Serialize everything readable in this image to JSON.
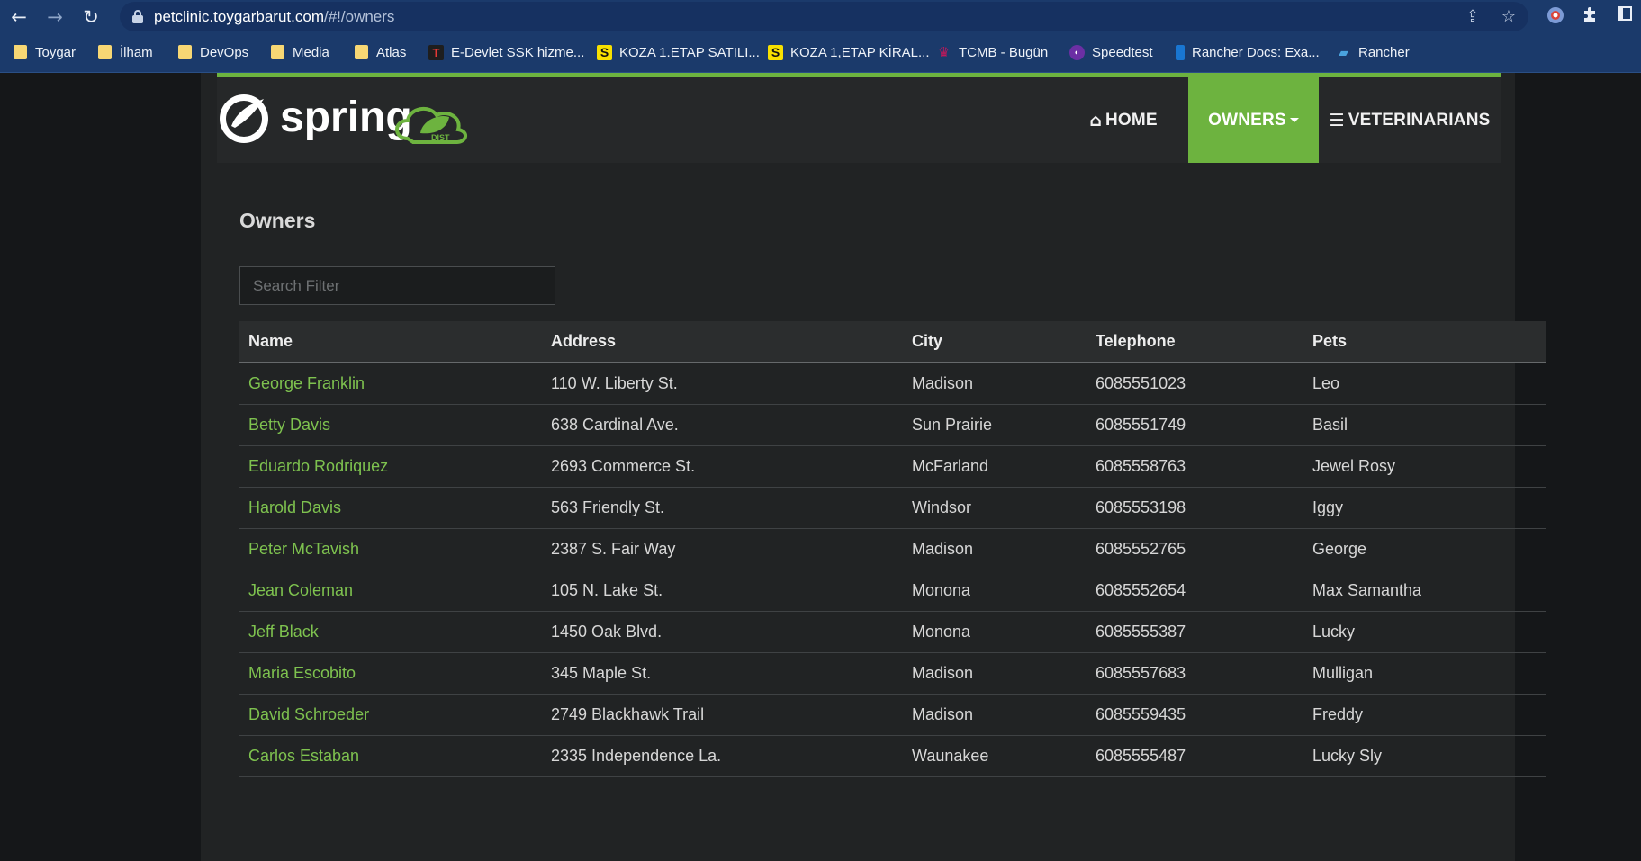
{
  "browser": {
    "url_host": "petclinic.toygarbarut.com",
    "url_path": "/#!/owners",
    "bookmarks": [
      {
        "label": "Toygar",
        "icon": "folder-icon"
      },
      {
        "label": "İlham",
        "icon": "folder-icon"
      },
      {
        "label": "DevOps",
        "icon": "folder-icon"
      },
      {
        "label": "Media",
        "icon": "folder-icon"
      },
      {
        "label": "Atlas",
        "icon": "folder-icon"
      },
      {
        "label": "E-Devlet SSK hizme...",
        "icon": "edevlet-icon"
      },
      {
        "label": "KOZA 1.ETAP SATILI...",
        "icon": "s-badge-icon"
      },
      {
        "label": "KOZA 1,ETAP KİRAL...",
        "icon": "s-badge-icon"
      },
      {
        "label": "TCMB - Bugün",
        "icon": "tcmb-icon"
      },
      {
        "label": "Speedtest",
        "icon": "speedtest-icon"
      },
      {
        "label": "Rancher Docs: Exa...",
        "icon": "rancher-docs-icon"
      },
      {
        "label": "Rancher",
        "icon": "rancher-icon"
      }
    ]
  },
  "navbar": {
    "home_label": "HOME",
    "owners_label": "OWNERS",
    "vets_label": "VETERINARIANS",
    "accent_color": "#6db33f"
  },
  "main": {
    "title": "Owners",
    "search_placeholder": "Search Filter",
    "columns": [
      "Name",
      "Address",
      "City",
      "Telephone",
      "Pets"
    ],
    "rows": [
      {
        "name": "George Franklin",
        "address": "110 W. Liberty St.",
        "city": "Madison",
        "telephone": "6085551023",
        "pets": "Leo"
      },
      {
        "name": "Betty Davis",
        "address": "638 Cardinal Ave.",
        "city": "Sun Prairie",
        "telephone": "6085551749",
        "pets": "Basil"
      },
      {
        "name": "Eduardo Rodriquez",
        "address": "2693 Commerce St.",
        "city": "McFarland",
        "telephone": "6085558763",
        "pets": "Jewel Rosy"
      },
      {
        "name": "Harold Davis",
        "address": "563 Friendly St.",
        "city": "Windsor",
        "telephone": "6085553198",
        "pets": "Iggy"
      },
      {
        "name": "Peter McTavish",
        "address": "2387 S. Fair Way",
        "city": "Madison",
        "telephone": "6085552765",
        "pets": "George"
      },
      {
        "name": "Jean Coleman",
        "address": "105 N. Lake St.",
        "city": "Monona",
        "telephone": "6085552654",
        "pets": "Max Samantha"
      },
      {
        "name": "Jeff Black",
        "address": "1450 Oak Blvd.",
        "city": "Monona",
        "telephone": "6085555387",
        "pets": "Lucky"
      },
      {
        "name": "Maria Escobito",
        "address": "345 Maple St.",
        "city": "Madison",
        "telephone": "6085557683",
        "pets": "Mulligan"
      },
      {
        "name": "David Schroeder",
        "address": "2749 Blackhawk Trail",
        "city": "Madison",
        "telephone": "6085559435",
        "pets": "Freddy"
      },
      {
        "name": "Carlos Estaban",
        "address": "2335 Independence La.",
        "city": "Waunakee",
        "telephone": "6085555487",
        "pets": "Lucky Sly"
      }
    ]
  }
}
